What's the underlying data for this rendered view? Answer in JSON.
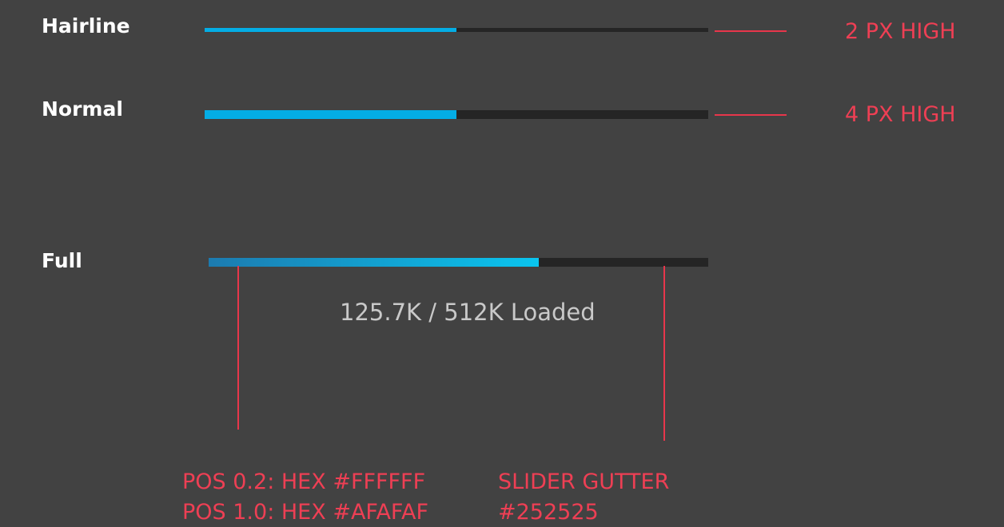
{
  "colors": {
    "background": "#424242",
    "fill": "#04ade5",
    "gutter": "#252525",
    "annotation": "#ee3f54"
  },
  "bars": [
    {
      "label": "Hairline",
      "progress": 0.5,
      "annotation": "2 PX HIGH"
    },
    {
      "label": "Normal",
      "progress": 0.5,
      "annotation": "4 PX HIGH"
    },
    {
      "label": "Full",
      "progress": 0.66,
      "status": "125.7K / 512K Loaded"
    }
  ],
  "notes": {
    "gradient_line1": "POS 0.2: HEX #FFFFFF",
    "gradient_line2": "POS 1.0: HEX #AFAFAF",
    "gutter_line1": "SLIDER GUTTER",
    "gutter_line2": "#252525"
  }
}
